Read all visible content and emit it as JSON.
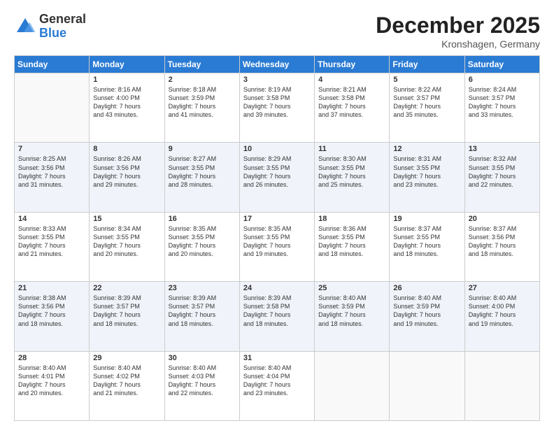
{
  "logo": {
    "general": "General",
    "blue": "Blue"
  },
  "header": {
    "month": "December 2025",
    "location": "Kronshagen, Germany"
  },
  "weekdays": [
    "Sunday",
    "Monday",
    "Tuesday",
    "Wednesday",
    "Thursday",
    "Friday",
    "Saturday"
  ],
  "weeks": [
    [
      {
        "num": "",
        "info": ""
      },
      {
        "num": "1",
        "info": "Sunrise: 8:16 AM\nSunset: 4:00 PM\nDaylight: 7 hours\nand 43 minutes."
      },
      {
        "num": "2",
        "info": "Sunrise: 8:18 AM\nSunset: 3:59 PM\nDaylight: 7 hours\nand 41 minutes."
      },
      {
        "num": "3",
        "info": "Sunrise: 8:19 AM\nSunset: 3:58 PM\nDaylight: 7 hours\nand 39 minutes."
      },
      {
        "num": "4",
        "info": "Sunrise: 8:21 AM\nSunset: 3:58 PM\nDaylight: 7 hours\nand 37 minutes."
      },
      {
        "num": "5",
        "info": "Sunrise: 8:22 AM\nSunset: 3:57 PM\nDaylight: 7 hours\nand 35 minutes."
      },
      {
        "num": "6",
        "info": "Sunrise: 8:24 AM\nSunset: 3:57 PM\nDaylight: 7 hours\nand 33 minutes."
      }
    ],
    [
      {
        "num": "7",
        "info": "Sunrise: 8:25 AM\nSunset: 3:56 PM\nDaylight: 7 hours\nand 31 minutes."
      },
      {
        "num": "8",
        "info": "Sunrise: 8:26 AM\nSunset: 3:56 PM\nDaylight: 7 hours\nand 29 minutes."
      },
      {
        "num": "9",
        "info": "Sunrise: 8:27 AM\nSunset: 3:55 PM\nDaylight: 7 hours\nand 28 minutes."
      },
      {
        "num": "10",
        "info": "Sunrise: 8:29 AM\nSunset: 3:55 PM\nDaylight: 7 hours\nand 26 minutes."
      },
      {
        "num": "11",
        "info": "Sunrise: 8:30 AM\nSunset: 3:55 PM\nDaylight: 7 hours\nand 25 minutes."
      },
      {
        "num": "12",
        "info": "Sunrise: 8:31 AM\nSunset: 3:55 PM\nDaylight: 7 hours\nand 23 minutes."
      },
      {
        "num": "13",
        "info": "Sunrise: 8:32 AM\nSunset: 3:55 PM\nDaylight: 7 hours\nand 22 minutes."
      }
    ],
    [
      {
        "num": "14",
        "info": "Sunrise: 8:33 AM\nSunset: 3:55 PM\nDaylight: 7 hours\nand 21 minutes."
      },
      {
        "num": "15",
        "info": "Sunrise: 8:34 AM\nSunset: 3:55 PM\nDaylight: 7 hours\nand 20 minutes."
      },
      {
        "num": "16",
        "info": "Sunrise: 8:35 AM\nSunset: 3:55 PM\nDaylight: 7 hours\nand 20 minutes."
      },
      {
        "num": "17",
        "info": "Sunrise: 8:35 AM\nSunset: 3:55 PM\nDaylight: 7 hours\nand 19 minutes."
      },
      {
        "num": "18",
        "info": "Sunrise: 8:36 AM\nSunset: 3:55 PM\nDaylight: 7 hours\nand 18 minutes."
      },
      {
        "num": "19",
        "info": "Sunrise: 8:37 AM\nSunset: 3:55 PM\nDaylight: 7 hours\nand 18 minutes."
      },
      {
        "num": "20",
        "info": "Sunrise: 8:37 AM\nSunset: 3:56 PM\nDaylight: 7 hours\nand 18 minutes."
      }
    ],
    [
      {
        "num": "21",
        "info": "Sunrise: 8:38 AM\nSunset: 3:56 PM\nDaylight: 7 hours\nand 18 minutes."
      },
      {
        "num": "22",
        "info": "Sunrise: 8:39 AM\nSunset: 3:57 PM\nDaylight: 7 hours\nand 18 minutes."
      },
      {
        "num": "23",
        "info": "Sunrise: 8:39 AM\nSunset: 3:57 PM\nDaylight: 7 hours\nand 18 minutes."
      },
      {
        "num": "24",
        "info": "Sunrise: 8:39 AM\nSunset: 3:58 PM\nDaylight: 7 hours\nand 18 minutes."
      },
      {
        "num": "25",
        "info": "Sunrise: 8:40 AM\nSunset: 3:59 PM\nDaylight: 7 hours\nand 18 minutes."
      },
      {
        "num": "26",
        "info": "Sunrise: 8:40 AM\nSunset: 3:59 PM\nDaylight: 7 hours\nand 19 minutes."
      },
      {
        "num": "27",
        "info": "Sunrise: 8:40 AM\nSunset: 4:00 PM\nDaylight: 7 hours\nand 19 minutes."
      }
    ],
    [
      {
        "num": "28",
        "info": "Sunrise: 8:40 AM\nSunset: 4:01 PM\nDaylight: 7 hours\nand 20 minutes."
      },
      {
        "num": "29",
        "info": "Sunrise: 8:40 AM\nSunset: 4:02 PM\nDaylight: 7 hours\nand 21 minutes."
      },
      {
        "num": "30",
        "info": "Sunrise: 8:40 AM\nSunset: 4:03 PM\nDaylight: 7 hours\nand 22 minutes."
      },
      {
        "num": "31",
        "info": "Sunrise: 8:40 AM\nSunset: 4:04 PM\nDaylight: 7 hours\nand 23 minutes."
      },
      {
        "num": "",
        "info": ""
      },
      {
        "num": "",
        "info": ""
      },
      {
        "num": "",
        "info": ""
      }
    ]
  ]
}
